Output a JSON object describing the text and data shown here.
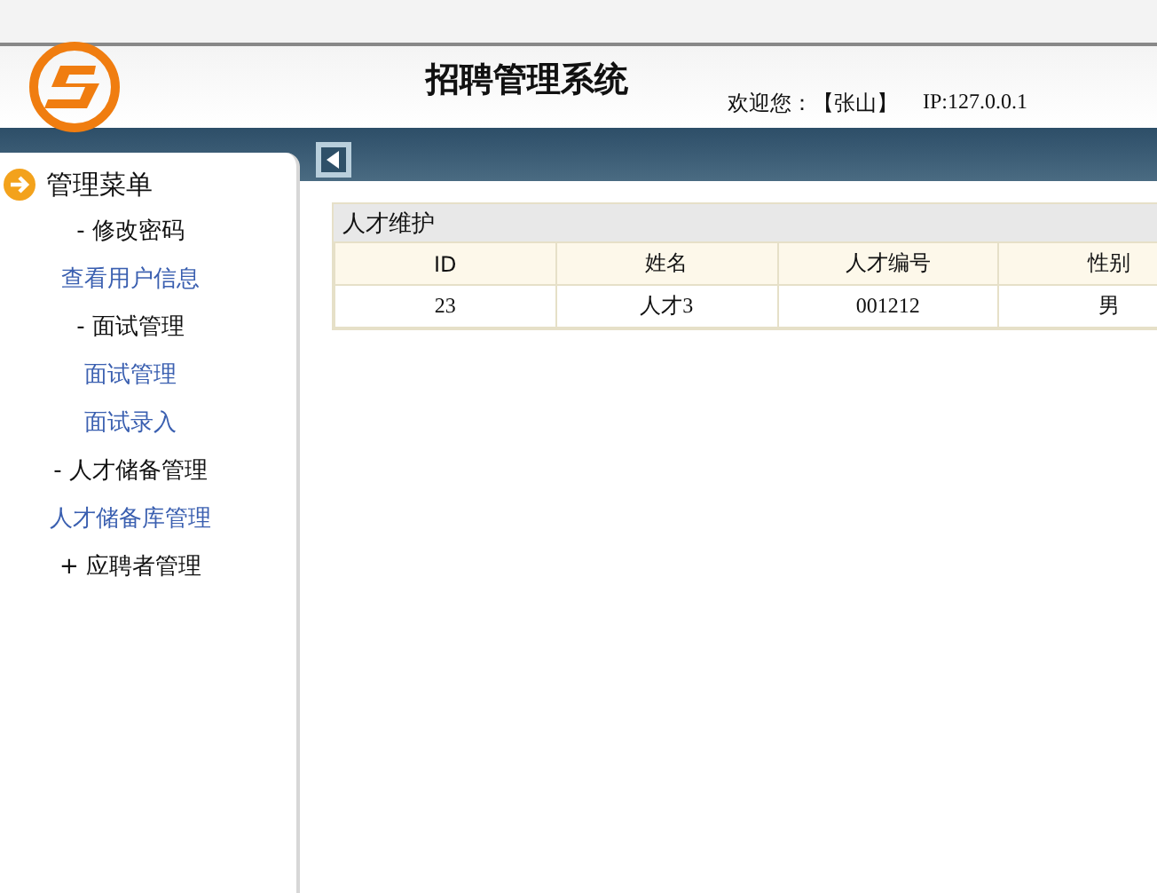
{
  "header": {
    "title": "招聘管理系统",
    "welcome": "欢迎您：【张山】",
    "ip": "IP:127.0.0.1"
  },
  "sidebar": {
    "title": "管理菜单",
    "items": [
      {
        "kind": "group",
        "label": "- 修改密码"
      },
      {
        "kind": "link",
        "label": "查看用户信息"
      },
      {
        "kind": "group",
        "label": "- 面试管理"
      },
      {
        "kind": "link",
        "label": "面试管理"
      },
      {
        "kind": "link",
        "label": "面试录入"
      },
      {
        "kind": "group",
        "label": "- 人才储备管理"
      },
      {
        "kind": "link",
        "label": "人才储备库管理"
      },
      {
        "kind": "group",
        "label": "+ 应聘者管理"
      }
    ]
  },
  "panel": {
    "title": "人才维护",
    "table": {
      "columns": [
        "ID",
        "姓名",
        "人才编号",
        "性别"
      ],
      "rows": [
        [
          "23",
          "人才3",
          "001212",
          "男"
        ]
      ]
    }
  }
}
